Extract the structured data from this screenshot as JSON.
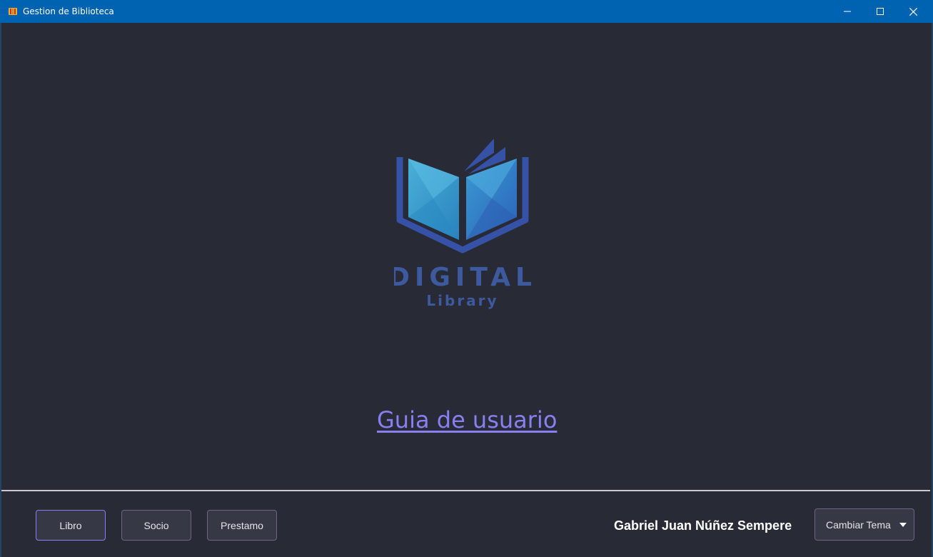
{
  "window": {
    "title": "Gestion de Biblioteca",
    "app_icon": "books-icon",
    "controls": [
      "minimize-icon",
      "maximize-icon",
      "close-icon"
    ]
  },
  "logo": {
    "word1": "DIGITAL",
    "word2": "Library",
    "color": "#3d5a9e"
  },
  "main": {
    "guide_link": "Guia de usuario",
    "link_color": "#8a7ff0"
  },
  "footer": {
    "buttons": [
      {
        "label": "Libro"
      },
      {
        "label": "Socio"
      },
      {
        "label": "Prestamo"
      }
    ],
    "user_name": "Gabriel Juan Núñez Sempere",
    "theme_combo": {
      "label": "Cambiar Tema",
      "icon": "caret-down-icon"
    }
  },
  "colors": {
    "background": "#282a36",
    "titlebar": "#0063b1",
    "accent": "#8a7ff0"
  }
}
